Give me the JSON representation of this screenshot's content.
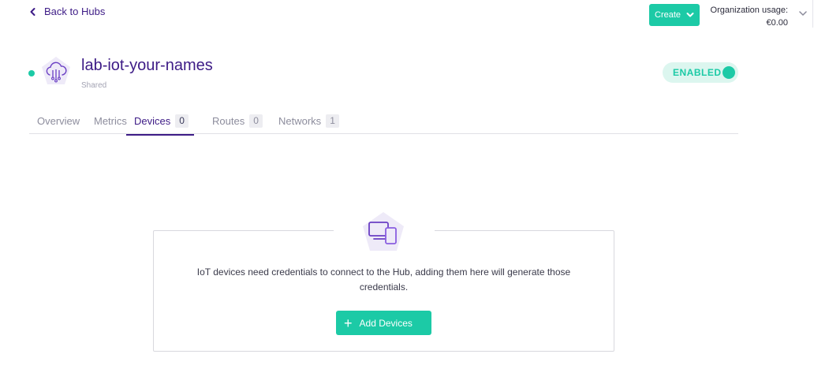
{
  "nav": {
    "back_label": "Back to Hubs"
  },
  "header": {
    "create_label": "Create",
    "usage_label": "Organization usage:",
    "usage_value": "€0.00"
  },
  "hub": {
    "name": "lab-iot-your-names",
    "subtitle": "Shared",
    "status": "ENABLED",
    "status_color": "#1ccaa6"
  },
  "tabs": [
    {
      "label": "Overview"
    },
    {
      "label": "Metrics"
    },
    {
      "label": "Devices",
      "count": "0",
      "active": true
    },
    {
      "label": "Routes",
      "count": "0"
    },
    {
      "label": "Networks",
      "count": "1"
    }
  ],
  "empty_state": {
    "message": "IoT devices need credentials to connect to the Hub, adding them here will generate those credentials.",
    "button_label": "Add Devices",
    "icon": "devices-icon"
  },
  "colors": {
    "accent": "#1ccaa6",
    "brand": "#3d1b86"
  }
}
